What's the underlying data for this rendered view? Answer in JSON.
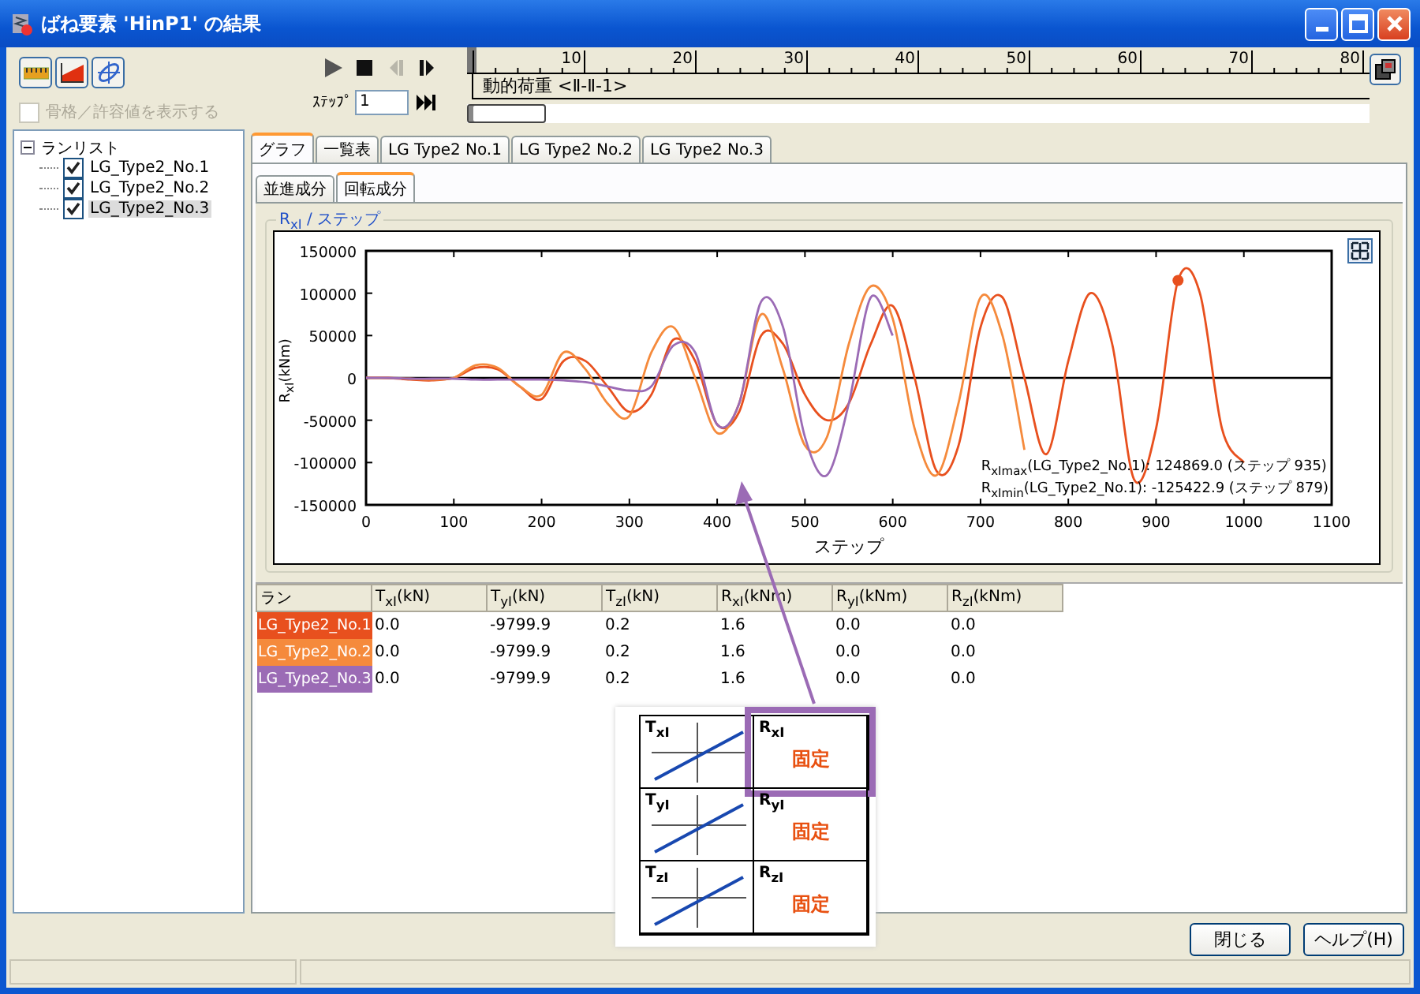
{
  "window": {
    "title": "ばね要素 'HinP1' の結果"
  },
  "show_frame": {
    "label": "骨格／許容値を表示する",
    "checked": false,
    "disabled": true
  },
  "player": {
    "controls": [
      {
        "kind": "play",
        "disabled": false
      },
      {
        "kind": "stop",
        "disabled": false
      },
      {
        "kind": "step_back",
        "disabled": true
      },
      {
        "kind": "step_forward",
        "disabled": false
      }
    ],
    "step_label": "ｽﾃｯﾌﾟ",
    "step_value": "1"
  },
  "timeline": {
    "labels": [
      "10",
      "20",
      "30",
      "40",
      "50",
      "60",
      "70",
      "80"
    ],
    "load_label": "動的荷重 <Ⅱ-Ⅱ-1>",
    "progress": {
      "level": 0
    }
  },
  "runs_tree": {
    "label": "ランリスト",
    "expanded": true,
    "children": [
      {
        "label": "LG_Type2_No.1",
        "checked": true,
        "selected": false
      },
      {
        "label": "LG_Type2_No.2",
        "checked": true,
        "selected": false
      },
      {
        "label": "LG_Type2_No.3",
        "checked": true,
        "selected": true
      }
    ]
  },
  "tabs": [
    {
      "label": "グラフ",
      "selected": true
    },
    {
      "label": "一覧表",
      "selected": false
    },
    {
      "label": "LG Type2 No.1",
      "selected": false
    },
    {
      "label": "LG Type2 No.2",
      "selected": false
    },
    {
      "label": "LG Type2 No.3",
      "selected": false
    }
  ],
  "subtabs": [
    {
      "label": "並進成分",
      "selected": false
    },
    {
      "label": "回転成分",
      "selected": true
    }
  ],
  "chart_panel": {
    "title": "R$_{xI}$ / ステップ",
    "extremes": [
      "R$_{xImax}$(LG_Type2_No.1):  124869.0 (ステップ 935)",
      "R$_{xImin}$(LG_Type2_No.1): -125422.9 (ステップ 879)"
    ],
    "chart_data": {
      "type": "line",
      "xlabel": "ステップ",
      "ylabel": "R$_{xI}$(kNm)",
      "xlim": [
        0,
        1100
      ],
      "ylim": [
        -150000,
        150000
      ],
      "xticks": [
        0,
        100,
        200,
        300,
        400,
        500,
        600,
        700,
        800,
        900,
        1000,
        1100
      ],
      "yticks": [
        -150000,
        -100000,
        -50000,
        0,
        50000,
        100000,
        150000
      ],
      "x": [
        0,
        25,
        50,
        75,
        100,
        125,
        150,
        175,
        200,
        225,
        250,
        275,
        300,
        325,
        350,
        375,
        400,
        425,
        450,
        475,
        500,
        525,
        550,
        575,
        600,
        625,
        650,
        675,
        700,
        725,
        750,
        775,
        800,
        825,
        850,
        875,
        900,
        925,
        950,
        975,
        1000
      ],
      "series": [
        {
          "color": "#e8501e",
          "values": [
            0,
            0,
            -2000,
            -3000,
            0,
            12000,
            10000,
            -10000,
            -25000,
            20000,
            20000,
            -10000,
            -40000,
            -20000,
            45000,
            20000,
            -55000,
            -40000,
            50000,
            40000,
            -20000,
            -50000,
            -30000,
            40000,
            85000,
            0,
            -110000,
            -80000,
            60000,
            95000,
            0,
            -90000,
            20000,
            100000,
            40000,
            -120000,
            -60000,
            115000,
            100000,
            -60000,
            -100000
          ]
        },
        {
          "color": "#f58a3c",
          "values": [
            0,
            0,
            -1000,
            -2000,
            0,
            15000,
            12000,
            -10000,
            -20000,
            30000,
            10000,
            -30000,
            -45000,
            30000,
            60000,
            0,
            -65000,
            -30000,
            75000,
            10000,
            -80000,
            -70000,
            40000,
            108000,
            70000,
            -60000,
            -115000,
            -30000,
            95000,
            50000,
            -85000,
            null,
            null,
            null,
            null,
            null,
            null,
            null,
            null,
            null,
            null
          ]
        },
        {
          "color": "#9b6bb5",
          "values": [
            0,
            0,
            -1000,
            -1000,
            -1000,
            -2000,
            -2000,
            -2000,
            -2000,
            -3000,
            -5000,
            -10000,
            -15000,
            -10000,
            38000,
            30000,
            -55000,
            -30000,
            90000,
            60000,
            -70000,
            -115000,
            -30000,
            95000,
            50000,
            null,
            null,
            null,
            null,
            null,
            null,
            null,
            null,
            null,
            null,
            null,
            null,
            null,
            null,
            null,
            null
          ]
        }
      ]
    }
  },
  "table": {
    "columns": [
      "ラン",
      "T$_{xI}$(kN)",
      "T$_{yI}$(kN)",
      "T$_{zI}$(kN)",
      "R$_{xI}$(kNm)",
      "R$_{yI}$(kNm)",
      "R$_{zI}$(kNm)"
    ],
    "rows": [
      {
        "color": "#e8501e",
        "cells": [
          "LG_Type2_No.1",
          "0.0",
          "-9799.9",
          "0.2",
          "1.6",
          "0.0",
          "0.0"
        ]
      },
      {
        "color": "#f58a3c",
        "cells": [
          "LG_Type2_No.2",
          "0.0",
          "-9799.9",
          "0.2",
          "1.6",
          "0.0",
          "0.0"
        ]
      },
      {
        "color": "#9b6bb5",
        "cells": [
          "LG_Type2_No.3",
          "0.0",
          "-9799.9",
          "0.2",
          "1.6",
          "0.0",
          "0.0"
        ]
      }
    ]
  },
  "callout": {
    "rows": [
      {
        "t_label": "T$_{xI}$",
        "r_label": "R$_{xI}$",
        "r_value": "固定",
        "selected": true
      },
      {
        "t_label": "T$_{yI}$",
        "r_label": "R$_{yI}$",
        "r_value": "固定",
        "selected": false
      },
      {
        "t_label": "T$_{zI}$",
        "r_label": "R$_{zI}$",
        "r_value": "固定",
        "selected": false
      }
    ]
  },
  "buttons": [
    {
      "label": "閉じる"
    },
    {
      "label": "ヘルプ(H)"
    }
  ]
}
